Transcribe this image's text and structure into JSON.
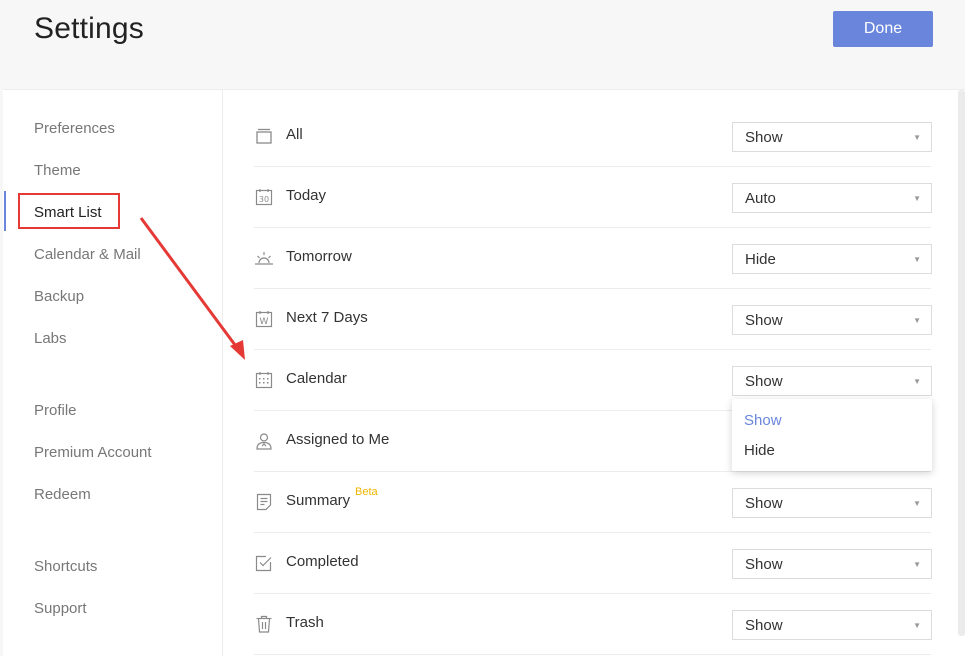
{
  "header": {
    "title": "Settings",
    "done_label": "Done"
  },
  "sidebar": {
    "items": [
      {
        "label": "Preferences"
      },
      {
        "label": "Theme"
      },
      {
        "label": "Smart List"
      },
      {
        "label": "Calendar & Mail"
      },
      {
        "label": "Backup"
      },
      {
        "label": "Labs"
      },
      {
        "label": "Profile"
      },
      {
        "label": "Premium Account"
      },
      {
        "label": "Redeem"
      },
      {
        "label": "Shortcuts"
      },
      {
        "label": "Support"
      }
    ],
    "active": "Smart List"
  },
  "smart_lists": [
    {
      "label": "All",
      "icon": "inbox-icon",
      "value": "Show"
    },
    {
      "label": "Today",
      "icon": "calendar-30-icon",
      "value": "Auto"
    },
    {
      "label": "Tomorrow",
      "icon": "sunrise-icon",
      "value": "Hide"
    },
    {
      "label": "Next 7 Days",
      "icon": "calendar-week-icon",
      "value": "Show"
    },
    {
      "label": "Calendar",
      "icon": "calendar-grid-icon",
      "value": "Show"
    },
    {
      "label": "Assigned to Me",
      "icon": "user-icon",
      "value": ""
    },
    {
      "label": "Summary",
      "icon": "summary-icon",
      "value": "Show",
      "badge": "Beta"
    },
    {
      "label": "Completed",
      "icon": "checkbox-icon",
      "value": "Show"
    },
    {
      "label": "Trash",
      "icon": "trash-icon",
      "value": "Show"
    }
  ],
  "dropdown": {
    "options": [
      "Show",
      "Hide"
    ],
    "selected": "Show"
  },
  "colors": {
    "accent": "#6a86dc",
    "annotation": "#e53935",
    "beta": "#f0b400"
  }
}
